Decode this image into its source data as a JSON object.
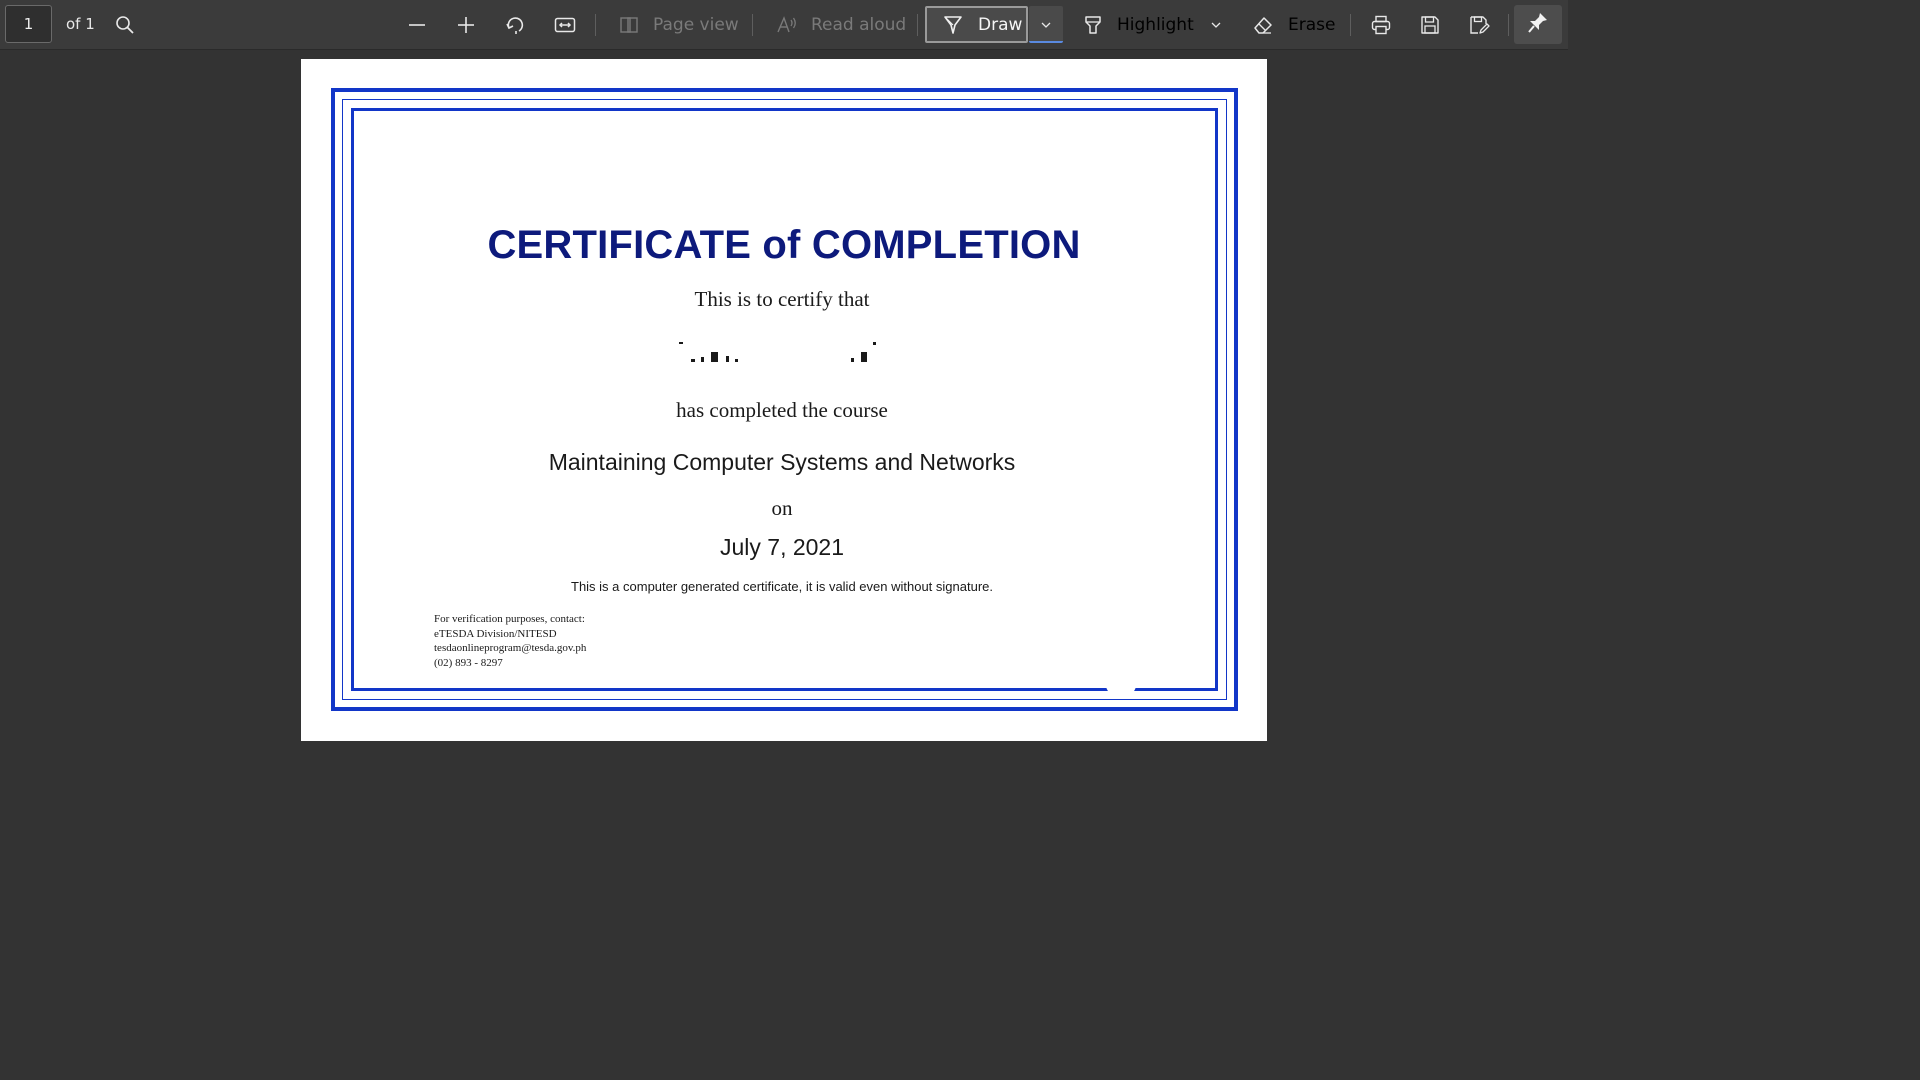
{
  "toolbar": {
    "page_number": "1",
    "page_count": "of 1",
    "page_view_label": "Page view",
    "read_aloud_label": "Read aloud",
    "draw_label": "Draw",
    "highlight_label": "Highlight",
    "erase_label": "Erase",
    "icons": {
      "search": "search-icon",
      "zoom_out": "minus-icon",
      "zoom_in": "plus-icon",
      "rotate": "rotate-icon",
      "fit": "fit-width-icon",
      "page_view": "page-view-icon",
      "read_aloud": "read-aloud-icon",
      "draw": "draw-pen-icon",
      "highlight": "highlighter-icon",
      "erase": "eraser-icon",
      "print": "print-icon",
      "save": "save-icon",
      "save_as": "save-as-icon",
      "pin": "pin-icon"
    },
    "colors": {
      "background": "#3b3b3b",
      "text": "#e8e8e8",
      "disabled": "#7a7a7a",
      "active_underline": "#5a8ae0"
    }
  },
  "document": {
    "title": "CERTIFICATE of COMPLETION",
    "certify_line": "This is to certify that",
    "completed_line": "has completed the course",
    "course_name": "Maintaining Computer Systems and Networks",
    "on_line": "on",
    "date": "July 7, 2021",
    "notice": "This is a computer generated certificate, it is valid even without signature.",
    "verification": {
      "line1": "For verification purposes, contact:",
      "line2": "eTESDA Division/NITESD",
      "line3": "tesdaonlineprogram@tesda.gov.ph",
      "line4": "(02) 893 - 8297"
    },
    "colors": {
      "border": "#1236c8",
      "title": "#0d1a7c",
      "viewer_background": "#333333"
    }
  }
}
